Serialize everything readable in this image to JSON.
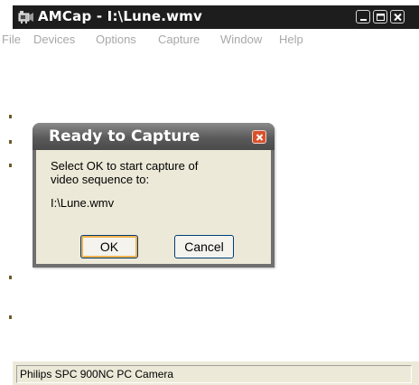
{
  "window": {
    "title": "AMCap - I:\\Lune.wmv"
  },
  "menu": [
    "File",
    "Devices",
    "Options",
    "Capture",
    "Window",
    "Help"
  ],
  "status": {
    "text": "Philips SPC 900NC PC Camera"
  },
  "dialog": {
    "title": "Ready to Capture",
    "message_line1": "Select OK to start capture of",
    "message_line2": "video sequence to:",
    "path": "I:\\Lune.wmv",
    "ok_label": "OK",
    "cancel_label": "Cancel"
  },
  "icons": {
    "app": "camera-icon",
    "minimize": "minimize-icon",
    "maximize": "maximize-icon",
    "close": "close-icon",
    "dialog_close": "close-icon"
  },
  "colors": {
    "titlebar": "#1d1d1d",
    "dialog_close": "#d8512c",
    "ok_focus": "#f4b350"
  }
}
